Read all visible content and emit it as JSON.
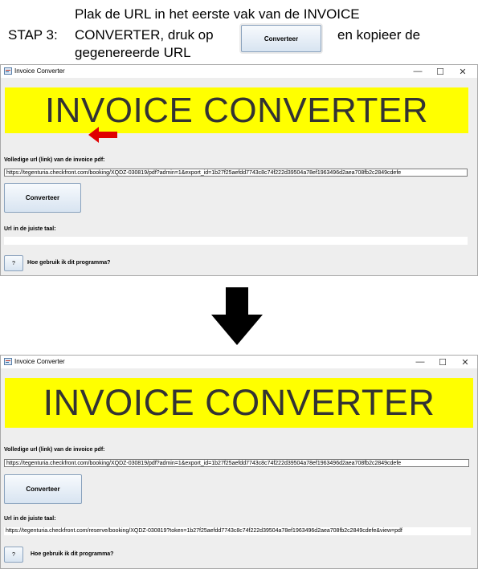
{
  "instruction": {
    "step": "STAP 3:",
    "line1": "Plak de URL in het eerste vak van de INVOICE",
    "line2_before": "CONVERTER, druk op",
    "button_label": "Converteer",
    "line2_after": "en kopieer de",
    "line3": "gegenereerde URL"
  },
  "window_before": {
    "title": "Invoice Converter",
    "controls": {
      "minimize": "—",
      "maximize": "☐",
      "close": "✕"
    },
    "banner": "INVOICE CONVERTER",
    "input_label": "Volledige url (link) van de invoice pdf:",
    "input_value": "https://tegenturia.checkfront.com/booking/XQDZ-030819/pdf?admin=1&export_id=1b27f25aefdd7743c8c74f222d39504a78ef1963496d2aea708fb2c2849cdefe",
    "convert_button": "Converteer",
    "output_label": "Url in de juiste taal:",
    "output_value": "",
    "help_button": "?",
    "help_text": "Hoe gebruik ik dit programma?"
  },
  "window_after": {
    "title": "Invoice Converter",
    "controls": {
      "minimize": "—",
      "maximize": "☐",
      "close": "✕"
    },
    "banner": "INVOICE CONVERTER",
    "input_label": "Volledige url (link) van de invoice pdf:",
    "input_value": "https://tegenturia.checkfront.com/booking/XQDZ-030819/pdf?admin=1&export_id=1b27f25aefdd7743c8c74f222d39504a78ef1963496d2aea708fb2c2849cdefe",
    "convert_button": "Converteer",
    "output_label": "Url in de juiste taal:",
    "output_value": "https://tegenturia.checkfront.com/reserve/booking/XQDZ-030819?token=1b27f25aefdd7743c8c74f222d39504a78ef1963496d2aea708fb2c2849cdefe&view=pdf",
    "help_button": "?",
    "help_text": "Hoe gebruik ik dit programma?"
  },
  "colors": {
    "banner_bg": "#ffff00",
    "banner_text": "#333333",
    "arrow_red": "#e00000",
    "arrow_black": "#000000"
  },
  "icons": {
    "pointer": "red-left-arrow-icon",
    "transition": "black-down-arrow-icon"
  }
}
